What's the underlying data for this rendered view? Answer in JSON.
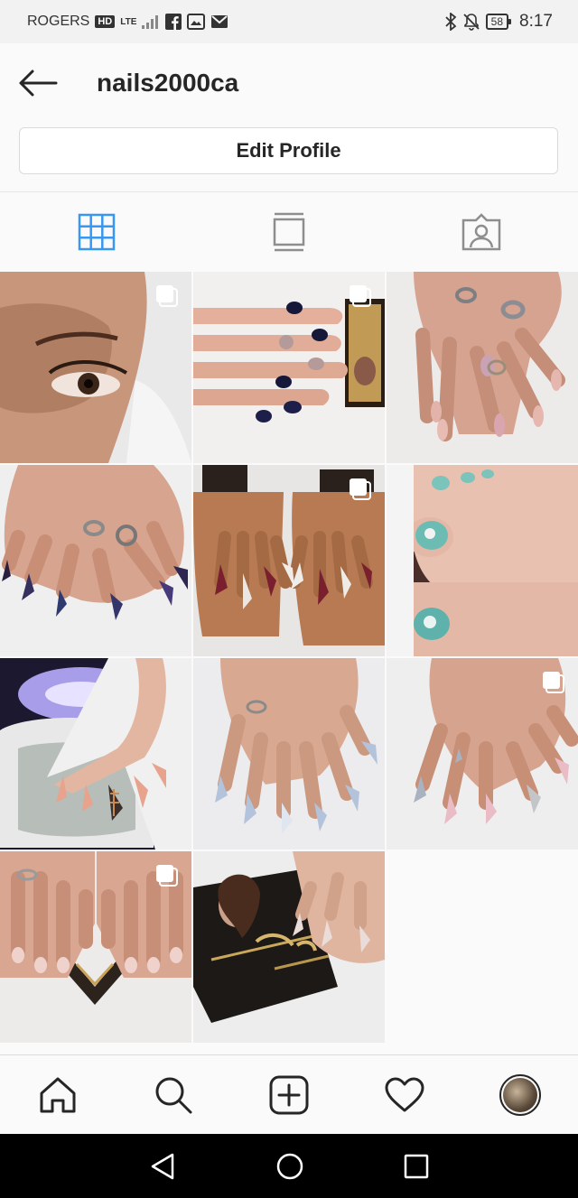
{
  "status_bar": {
    "carrier": "ROGERS",
    "hd_badge": "HD",
    "network": "LTE",
    "battery": "58",
    "time": "8:17",
    "icons": [
      "facebook-icon",
      "gallery-icon",
      "mail-icon",
      "bluetooth-icon",
      "mute-icon"
    ]
  },
  "header": {
    "username": "nails2000ca",
    "back_icon": "arrow-left-icon"
  },
  "profile": {
    "edit_label": "Edit Profile"
  },
  "tabs": [
    {
      "name": "grid",
      "icon": "grid-icon",
      "active": true
    },
    {
      "name": "feed",
      "icon": "feed-icon",
      "active": false
    },
    {
      "name": "tagged",
      "icon": "tagged-person-icon",
      "active": false
    }
  ],
  "posts": [
    {
      "subject": "eye close-up",
      "multiple": true
    },
    {
      "subject": "navy nails with business card",
      "multiple": true
    },
    {
      "subject": "pink glitter nails with rings",
      "multiple": false
    },
    {
      "subject": "chrome stiletto nails",
      "multiple": false
    },
    {
      "subject": "burgundy stiletto nail art",
      "multiple": true
    },
    {
      "subject": "teal toe nail art",
      "multiple": false
    },
    {
      "subject": "peach nails under UV lamp",
      "multiple": false
    },
    {
      "subject": "baby blue coffin nails",
      "multiple": false
    },
    {
      "subject": "pink and silver glitter nails",
      "multiple": true
    },
    {
      "subject": "natural pink nails",
      "multiple": true
    },
    {
      "subject": "nails with Nails 2000 card",
      "multiple": false
    }
  ],
  "bottom_nav": [
    "home-icon",
    "search-icon",
    "add-post-icon",
    "activity-heart-icon",
    "profile-avatar"
  ],
  "colors": {
    "accent": "#3897f0",
    "text": "#262626",
    "border": "#dbdbdb"
  }
}
